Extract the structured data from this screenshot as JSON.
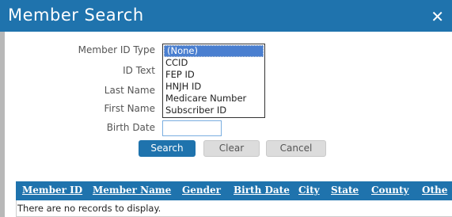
{
  "dialog": {
    "title": "Member Search"
  },
  "form": {
    "member_id_type_label": "Member ID Type",
    "id_text_label": "ID Text",
    "last_name_label": "Last Name",
    "first_name_label": "First Name",
    "birth_date_label": "Birth Date",
    "birth_date_value": "",
    "member_id_type_options": [
      "(None)",
      "CCID",
      "FEP ID",
      "HNJH ID",
      "Medicare Number",
      "Subscriber ID"
    ],
    "member_id_type_selected": "(None)"
  },
  "buttons": {
    "search": "Search",
    "clear": "Clear",
    "cancel": "Cancel"
  },
  "grid": {
    "columns": [
      "Member ID",
      "Member Name",
      "Gender",
      "Birth Date",
      "City",
      "State",
      "County",
      "Othe"
    ],
    "empty_message": "There are no records to display."
  },
  "colors": {
    "header": "#1f73ad",
    "selected_option": "#4a7fd0"
  }
}
